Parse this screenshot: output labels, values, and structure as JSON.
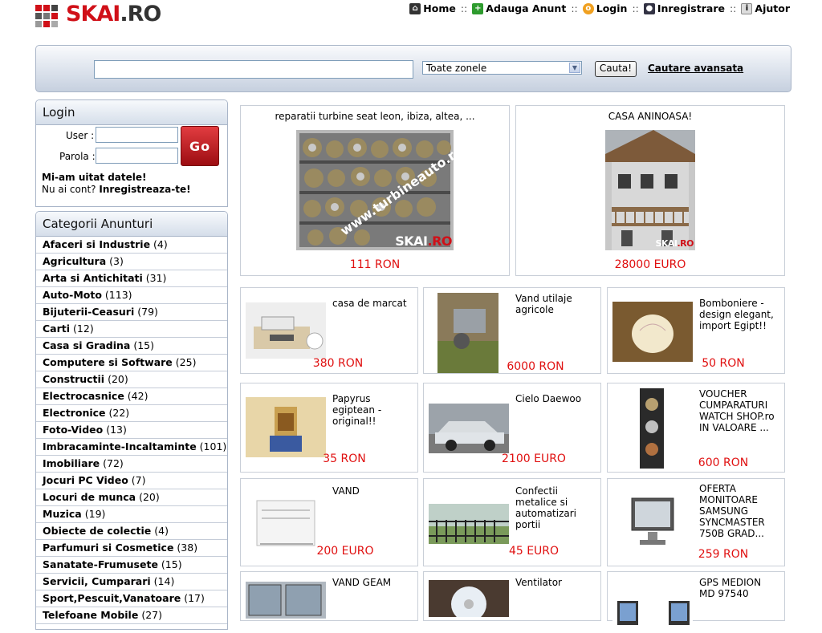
{
  "header": {
    "logo_text": "SKAI",
    "logo_suffix": ".RO",
    "nav": [
      {
        "label": "Home",
        "icon": "home-icon"
      },
      {
        "label": "Adauga Anunt",
        "icon": "plus-icon"
      },
      {
        "label": "Login",
        "icon": "key-icon"
      },
      {
        "label": "Inregistrare",
        "icon": "register-icon"
      },
      {
        "label": "Ajutor",
        "icon": "info-icon"
      }
    ],
    "separator": "::"
  },
  "search": {
    "query": "",
    "zone_selected": "Toate zonele",
    "button": "Cauta!",
    "advanced": "Cautare avansata"
  },
  "login": {
    "title": "Login",
    "user_label": "User :",
    "password_label": "Parola :",
    "go": "Go",
    "forgot": "Mi-am uitat datele!",
    "no_account": "Nu ai cont?",
    "register": "Inregistreaza-te!"
  },
  "categories": {
    "title": "Categorii Anunturi",
    "items": [
      {
        "name": "Afaceri si Industrie",
        "count": "(4)"
      },
      {
        "name": "Agricultura",
        "count": "(3)"
      },
      {
        "name": "Arta si Antichitati",
        "count": "(31)"
      },
      {
        "name": "Auto-Moto",
        "count": "(113)"
      },
      {
        "name": "Bijuterii-Ceasuri",
        "count": "(79)"
      },
      {
        "name": "Carti",
        "count": "(12)"
      },
      {
        "name": "Casa si Gradina",
        "count": "(15)"
      },
      {
        "name": "Computere si Software",
        "count": "(25)"
      },
      {
        "name": "Constructii",
        "count": "(20)"
      },
      {
        "name": "Electrocasnice",
        "count": "(42)"
      },
      {
        "name": "Electronice",
        "count": "(22)"
      },
      {
        "name": "Foto-Video",
        "count": "(13)"
      },
      {
        "name": "Imbracaminte-Incaltaminte",
        "count": "(101)"
      },
      {
        "name": "Imobiliare",
        "count": "(72)"
      },
      {
        "name": "Jocuri PC Video",
        "count": "(7)"
      },
      {
        "name": "Locuri de munca",
        "count": "(20)"
      },
      {
        "name": "Muzica",
        "count": "(19)"
      },
      {
        "name": "Obiecte de colectie",
        "count": "(4)"
      },
      {
        "name": "Parfumuri si Cosmetice",
        "count": "(38)"
      },
      {
        "name": "Sanatate-Frumusete",
        "count": "(15)"
      },
      {
        "name": "Servicii, Cumparari",
        "count": "(14)"
      },
      {
        "name": "Sport,Pescuit,Vanatoare",
        "count": "(17)"
      },
      {
        "name": "Telefoane Mobile",
        "count": "(27)"
      }
    ]
  },
  "featured": [
    {
      "title": "reparatii turbine seat leon, ibiza, altea, ...",
      "price": "111 RON",
      "watermark": "www.turbineauto.ro"
    },
    {
      "title": "CASA ANINOASA!",
      "price": "28000 EURO"
    }
  ],
  "listings": [
    {
      "title": "casa de marcat",
      "price": "380 RON"
    },
    {
      "title": "Vand utilaje agricole",
      "price": "6000 RON"
    },
    {
      "title": "Bomboniere - design elegant, import Egipt!!",
      "price": "50 RON"
    },
    {
      "title": "Papyrus egiptean - original!!",
      "price": "35 RON"
    },
    {
      "title": "Cielo Daewoo",
      "price": "2100 EURO"
    },
    {
      "title": "VOUCHER CUMPARATURI WATCH SHOP.ro IN VALOARE ...",
      "price": "600 RON"
    },
    {
      "title": "VAND",
      "price": "200 EURO"
    },
    {
      "title": "Confectii metalice si automatizari portii",
      "price": "45 EURO"
    },
    {
      "title": "OFERTA MONITOARE SAMSUNG SYNCMASTER 750B GRAD...",
      "price": "259 RON"
    },
    {
      "title": "VAND GEAM",
      "price": ""
    },
    {
      "title": "Ventilator",
      "price": ""
    },
    {
      "title": "GPS MEDION MD 97540",
      "price": ""
    }
  ],
  "colors": {
    "brand_red": "#d01018",
    "price_red": "#e01010",
    "border": "#a9b5c8"
  }
}
